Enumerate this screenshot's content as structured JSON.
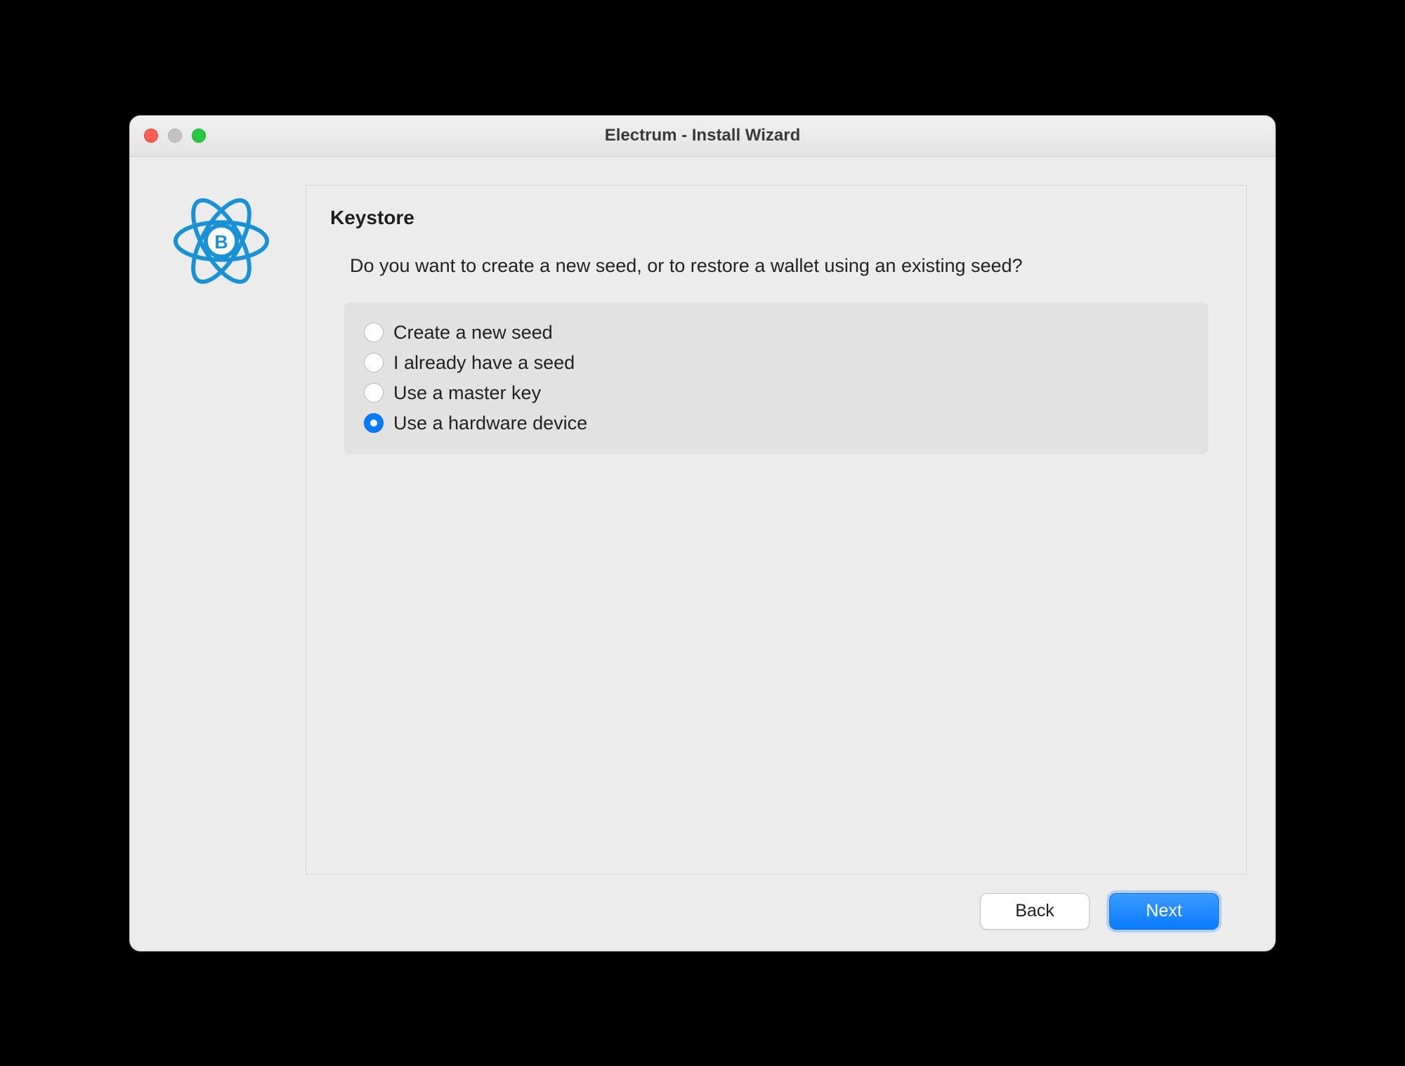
{
  "window": {
    "title": "Electrum  -  Install Wizard"
  },
  "panel": {
    "heading": "Keystore",
    "question": "Do you want to create a new seed, or to restore a wallet using an existing seed?"
  },
  "options": [
    {
      "label": "Create a new seed",
      "selected": false
    },
    {
      "label": "I already have a seed",
      "selected": false
    },
    {
      "label": "Use a master key",
      "selected": false
    },
    {
      "label": "Use a hardware device",
      "selected": true
    }
  ],
  "buttons": {
    "back": "Back",
    "next": "Next"
  }
}
